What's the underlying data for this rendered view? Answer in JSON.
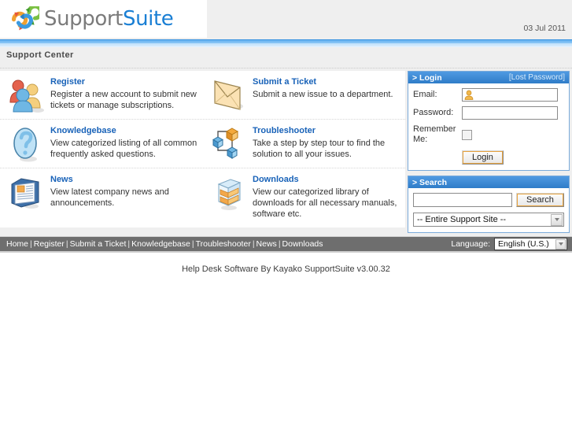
{
  "header": {
    "logo_text_primary": "Support",
    "logo_text_secondary": "Suite",
    "logo_icon": "recycle-arrows-icon",
    "date": "03 Jul 2011"
  },
  "page": {
    "title": "Support Center"
  },
  "tiles": [
    {
      "icon": "users-group-icon",
      "title": "Register",
      "desc": "Register a new account to submit new tickets or manage subscriptions."
    },
    {
      "icon": "envelope-icon",
      "title": "Submit a Ticket",
      "desc": "Submit a new issue to a department."
    },
    {
      "icon": "question-mark-icon",
      "title": "Knowledgebase",
      "desc": "View categorized listing of all common frequently asked questions."
    },
    {
      "icon": "network-nodes-icon",
      "title": "Troubleshooter",
      "desc": "Take a step by step tour to find the solution to all your issues."
    },
    {
      "icon": "newspaper-icon",
      "title": "News",
      "desc": "View latest company news and announcements."
    },
    {
      "icon": "download-box-icon",
      "title": "Downloads",
      "desc": "View our categorized library of downloads for all necessary manuals, software etc."
    }
  ],
  "login_panel": {
    "heading": "> Login",
    "lost_password_link": "[Lost Password]",
    "email_label": "Email:",
    "email_value": "",
    "email_icon": "user-avatar-icon",
    "password_label": "Password:",
    "password_value": "",
    "remember_label": "Remember Me:",
    "remember_checked": false,
    "login_button": "Login"
  },
  "search_panel": {
    "heading": "> Search",
    "search_value": "",
    "search_button": "Search",
    "scope_selected": "-- Entire Support Site --"
  },
  "footer": {
    "links": [
      "Home",
      "Register",
      "Submit a Ticket",
      "Knowledgebase",
      "Troubleshooter",
      "News",
      "Downloads"
    ],
    "separator": "|",
    "language_label": "Language:",
    "language_selected": "English (U.S.)",
    "copyright": "Help Desk Software By Kayako SupportSuite v3.00.32"
  },
  "colors": {
    "link_blue": "#1862b8",
    "panel_blue": "#2f7cc8",
    "footer_grey": "#6e6e6e",
    "page_grey": "#efefef"
  }
}
